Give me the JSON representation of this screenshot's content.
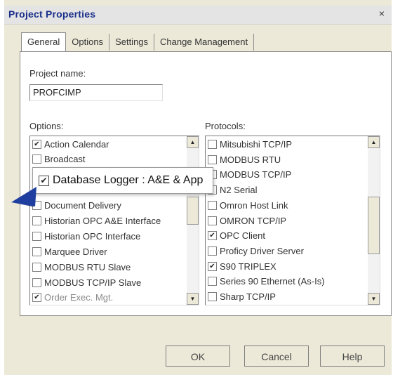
{
  "window": {
    "title": "Project Properties",
    "close_glyph": "×"
  },
  "tabs": [
    {
      "label": "General"
    },
    {
      "label": "Options"
    },
    {
      "label": "Settings"
    },
    {
      "label": "Change Management"
    }
  ],
  "project": {
    "label": "Project name:",
    "value": "PROFCIMP"
  },
  "options": {
    "label": "Options:",
    "items": [
      {
        "label": "Action Calendar",
        "checked": true
      },
      {
        "label": "Broadcast",
        "checked": false
      },
      {
        "label": "Document Delivery",
        "checked": false
      },
      {
        "label": "Historian OPC A&E Interface",
        "checked": false
      },
      {
        "label": "Historian OPC Interface",
        "checked": false
      },
      {
        "label": "Marquee Driver",
        "checked": false
      },
      {
        "label": "MODBUS RTU Slave",
        "checked": false
      },
      {
        "label": "MODBUS TCP/IP Slave",
        "checked": false
      },
      {
        "label": "Order Exec. Mgt.",
        "checked": true
      }
    ]
  },
  "callout": {
    "label": "Database Logger : A&E & App",
    "checked": true
  },
  "protocols": {
    "label": "Protocols:",
    "items": [
      {
        "label": "Mitsubishi TCP/IP",
        "checked": false
      },
      {
        "label": "MODBUS RTU",
        "checked": false
      },
      {
        "label": "MODBUS TCP/IP",
        "checked": false
      },
      {
        "label": "N2 Serial",
        "checked": false
      },
      {
        "label": "Omron Host Link",
        "checked": false
      },
      {
        "label": "OMRON TCP/IP",
        "checked": false
      },
      {
        "label": "OPC Client",
        "checked": true
      },
      {
        "label": "Proficy Driver Server",
        "checked": false
      },
      {
        "label": "S90 TRIPLEX",
        "checked": true
      },
      {
        "label": "Series 90 Ethernet (As-Is)",
        "checked": false
      },
      {
        "label": "Sharp TCP/IP",
        "checked": false
      }
    ]
  },
  "buttons": {
    "ok": "OK",
    "cancel": "Cancel",
    "help": "Help"
  },
  "colors": {
    "title": "#1a2f8a",
    "pointer": "#1f3fa0"
  }
}
